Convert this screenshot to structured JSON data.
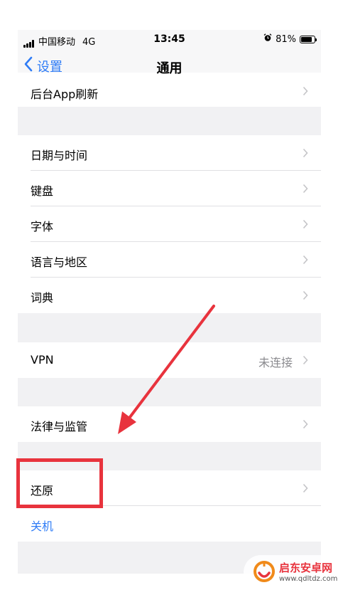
{
  "status_bar": {
    "carrier": "中国移动",
    "network": "4G",
    "time": "13:45",
    "battery": "81%",
    "battery_level": 0.81
  },
  "nav": {
    "back_label": "设置",
    "title": "通用"
  },
  "rows": {
    "background_refresh": "后台App刷新",
    "date_time": "日期与时间",
    "keyboard": "键盘",
    "fonts": "字体",
    "language_region": "语言与地区",
    "dictionary": "词典",
    "vpn": "VPN",
    "vpn_status": "未连接",
    "legal": "法律与监管",
    "reset": "还原",
    "shutdown": "关机"
  },
  "watermark": {
    "title": "启东安卓网",
    "url": "www.qdltdz.com"
  },
  "colors": {
    "accent": "#2f7cf6",
    "annotation": "#e8333d",
    "grouped_bg": "#f1f1f3"
  }
}
